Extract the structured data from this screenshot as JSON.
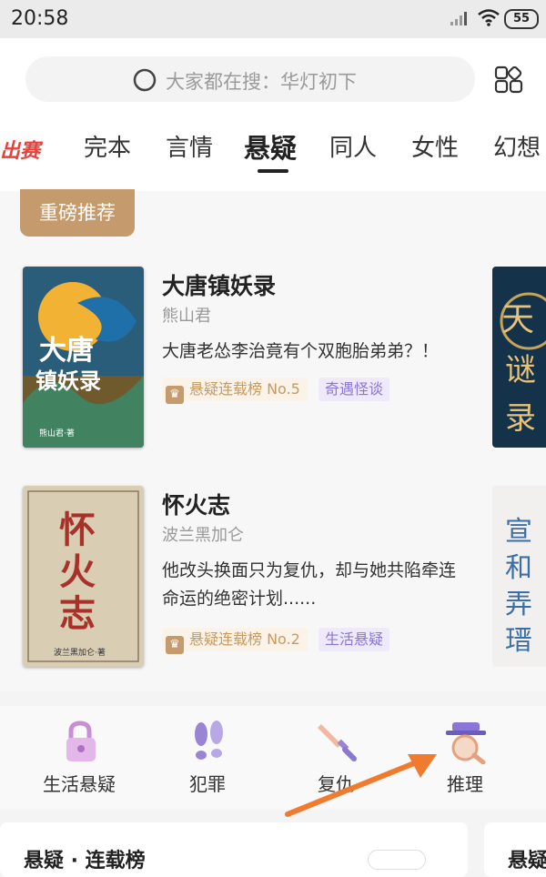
{
  "status": {
    "time": "20:58",
    "battery": "55"
  },
  "search": {
    "placeholder": "大家都在搜：华灯初下"
  },
  "tabs": [
    {
      "label": "完本",
      "active": false
    },
    {
      "label": "言情",
      "active": false
    },
    {
      "label": "悬疑",
      "active": true
    },
    {
      "label": "同人",
      "active": false
    },
    {
      "label": "女性",
      "active": false
    },
    {
      "label": "幻想",
      "active": false
    }
  ],
  "section": {
    "badge": "重磅推荐"
  },
  "books": [
    {
      "title": "大唐镇妖录",
      "author": "熊山君",
      "desc": "大唐老怂李治竟有个双胞胎弟弟？！",
      "rank": "悬疑连载榜 No.5",
      "category": "奇遇怪谈",
      "cover_title": "大唐镇妖录",
      "cover_author": "熊山君·著",
      "cover_color": "#2a5d7a"
    },
    {
      "title": "怀火志",
      "author": "波兰黑加仑",
      "desc": "他改头换面只为复仇，却与她共陷牵连命运的绝密计划......",
      "rank": "悬疑连载榜 No.2",
      "category": "生活悬疑",
      "cover_title": "怀火志",
      "cover_author": "波兰黑加仑·著",
      "cover_color": "#d9cdb4"
    }
  ],
  "categories": [
    {
      "label": "生活悬疑",
      "icon": "lock-icon",
      "color": "#c98fd6"
    },
    {
      "label": "犯罪",
      "icon": "footprints-icon",
      "color": "#9a84d6"
    },
    {
      "label": "复仇",
      "icon": "dagger-icon",
      "color": "#e79a7a"
    },
    {
      "label": "推理",
      "icon": "detective-icon",
      "color": "#8a76d6"
    }
  ],
  "bottom": {
    "card_title": "悬疑 · 连载榜",
    "card2_title": "悬疑"
  },
  "colors": {
    "accent_gold": "#c59b6d",
    "tag_purple": "#8a76d6",
    "arrow": "#f07b2f"
  }
}
